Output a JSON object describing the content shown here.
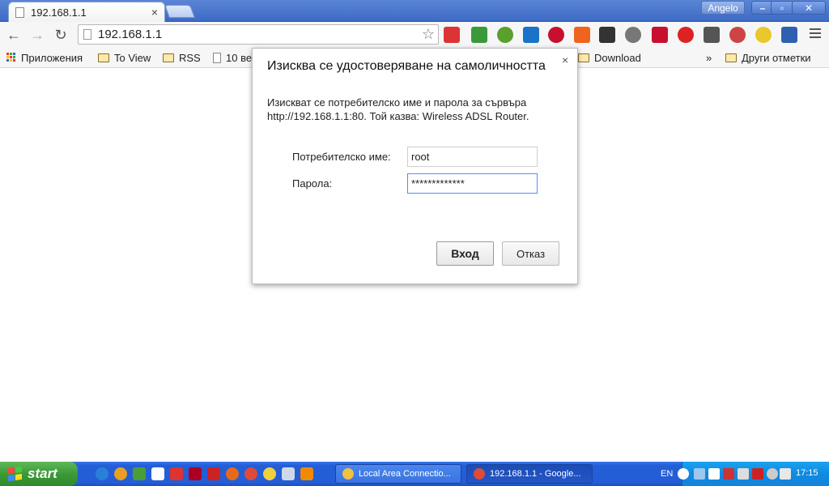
{
  "window": {
    "tab_title": "192.168.1.1",
    "tab_close": "×",
    "user": "Angelo",
    "min": "–",
    "max": "▫",
    "close": "✕"
  },
  "toolbar": {
    "back": "←",
    "forward": "→",
    "reload": "↻",
    "url": "192.168.1.1",
    "star": "☆"
  },
  "bookmarks": {
    "apps": "Приложения",
    "items": [
      "To View",
      "RSS",
      "10 ве"
    ],
    "download": "Download",
    "overflow": "»",
    "other": "Други отметки"
  },
  "dialog": {
    "title": "Изисква се удостоверяване на самоличността",
    "close": "×",
    "message": "Изискват се потребителско име и парола за сървъра http://192.168.1.1:80. Той казва: Wireless ADSL Router.",
    "username_label": "Потребителско име:",
    "username_value": "root",
    "password_label": "Парола:",
    "password_value": "*************",
    "login": "Вход",
    "cancel": "Отказ"
  },
  "taskbar": {
    "start": "start",
    "tasks": [
      "Local Area Connectio...",
      "192.168.1.1 - Google..."
    ],
    "lang": "EN",
    "clock": "17:15"
  },
  "colors": {
    "accent_focus": "#4d90fe",
    "taskbar_blue": "#245ed6",
    "start_green": "#3c9a37"
  }
}
